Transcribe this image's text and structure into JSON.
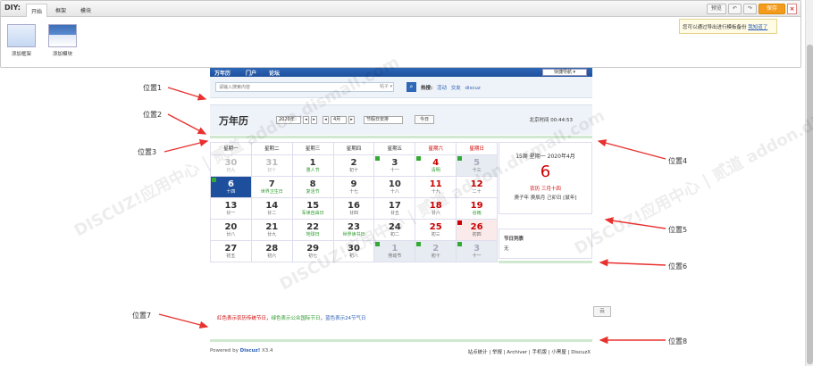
{
  "diy": {
    "title": "DIY:",
    "tabs": [
      "开始",
      "框架",
      "模块"
    ],
    "right_buttons": [
      "预览",
      "↶",
      "↷"
    ],
    "save_label": "保存",
    "close_label": "×",
    "tools": [
      {
        "label": "添加框架",
        "icon": "frame-icon"
      },
      {
        "label": "添加模块",
        "icon": "module-icon"
      }
    ],
    "tip_text": "您可以通过导出进行模板备份",
    "tip_link": "我知道了"
  },
  "nav": {
    "items": [
      "万年历",
      "门户",
      "论坛"
    ],
    "quick_nav": "快捷导航 ▾"
  },
  "search": {
    "placeholder": "请输入搜索内容",
    "scope": "帖子 ▾",
    "button": "⌕",
    "hot_label": "热搜:",
    "hot_items": [
      "活动",
      "交友",
      "discuz"
    ]
  },
  "calendar": {
    "title": "万年历",
    "year_select": "2020年",
    "month_select": "4月",
    "holiday_select": "节假日安排",
    "today_label": "今日",
    "bj_time": "北京时间 00:44:53",
    "weekdays": [
      "星期一",
      "星期二",
      "星期三",
      "星期四",
      "星期五",
      "星期六",
      "星期日"
    ],
    "rows": [
      [
        [
          "30",
          "初九",
          "other",
          ""
        ],
        [
          "31",
          "初十",
          "other",
          ""
        ],
        [
          "1",
          "愚人节",
          "fest",
          ""
        ],
        [
          "2",
          "初十",
          "",
          ""
        ],
        [
          "3",
          "十一",
          "",
          "xiu"
        ],
        [
          "4",
          "清明",
          "wkend fest",
          "xiu"
        ],
        [
          "5",
          "十三",
          "wkend otherw",
          "xiu"
        ]
      ],
      [
        [
          "6",
          "十四",
          "selected",
          "xiu"
        ],
        [
          "7",
          "世界卫生日",
          "fest",
          ""
        ],
        [
          "8",
          "复活节",
          "fest",
          ""
        ],
        [
          "9",
          "十七",
          "",
          ""
        ],
        [
          "10",
          "十八",
          "",
          ""
        ],
        [
          "11",
          "十九",
          "wkend",
          ""
        ],
        [
          "12",
          "二十",
          "wkend",
          ""
        ]
      ],
      [
        [
          "13",
          "廿一",
          "",
          ""
        ],
        [
          "14",
          "廿二",
          "",
          ""
        ],
        [
          "15",
          "军读自由日",
          "fest",
          ""
        ],
        [
          "16",
          "廿四",
          "",
          ""
        ],
        [
          "17",
          "廿五",
          "",
          ""
        ],
        [
          "18",
          "廿六",
          "wkend",
          ""
        ],
        [
          "19",
          "谷雨",
          "wkend fest",
          ""
        ]
      ],
      [
        [
          "20",
          "廿八",
          "",
          ""
        ],
        [
          "21",
          "廿九",
          "",
          ""
        ],
        [
          "22",
          "地球日",
          "fest",
          ""
        ],
        [
          "23",
          "世界读书日",
          "fest",
          ""
        ],
        [
          "24",
          "初二",
          "",
          ""
        ],
        [
          "25",
          "初三",
          "wkend",
          ""
        ],
        [
          "26",
          "初四",
          "wkend holiday",
          "ban"
        ]
      ],
      [
        [
          "27",
          "初五",
          "",
          ""
        ],
        [
          "28",
          "初六",
          "",
          ""
        ],
        [
          "29",
          "初七",
          "",
          ""
        ],
        [
          "30",
          "初八",
          "",
          ""
        ],
        [
          "1",
          "劳动节",
          "otherw",
          "xiu"
        ],
        [
          "2",
          "初十",
          "otherw",
          "xiu"
        ],
        [
          "3",
          "十一",
          "otherw",
          "xiu"
        ]
      ]
    ],
    "legend_red": "红色表示农历传统节日",
    "legend_sep1": "，",
    "legend_green": "绿色表示公众国际节日",
    "legend_sep2": "，",
    "legend_blue": "蓝色表示24节气日"
  },
  "info": {
    "week_line": "15周 星期一 2020年4月",
    "day": "6",
    "lunar": "农历 三月十四",
    "ganzhi": "庚子年 庚辰月 己卯日 [鼠年]"
  },
  "festival": {
    "title": "节日列表",
    "value": "无"
  },
  "footer": {
    "powered": "Powered by",
    "brand": "Discuz!",
    "version": "X3.4",
    "links": "站点统计 | 举报 | Archiver | 手机版 | 小黑屋 | DiscuzX"
  },
  "small_button": "云",
  "positions": [
    "位置1",
    "位置2",
    "位置3",
    "位置4",
    "位置5",
    "位置6",
    "位置7",
    "位置8"
  ],
  "watermark": "DISCUZ!应用中心 | 贰道  addon.dismall.com"
}
